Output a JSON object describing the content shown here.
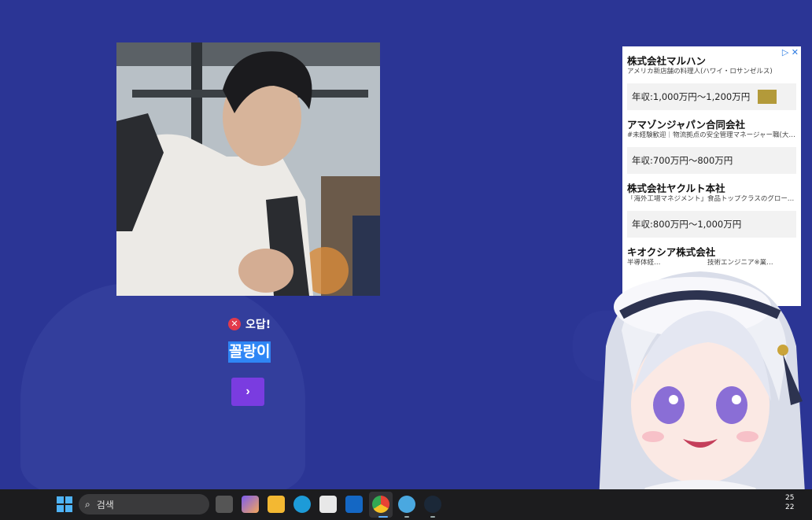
{
  "quiz": {
    "result_icon": "close-circle-icon",
    "result_text": "오답!",
    "answer": "꼴랑이",
    "next_icon": "chevron-right-icon",
    "next_glyph": "›"
  },
  "ad": {
    "top_icons": "▷ ✕",
    "items": [
      {
        "company": "株式会社マルハン",
        "subtitle": "アメリカ新店舗の料理人(ハワイ・ロサンゼルス)",
        "salary": "年収:1,000万円〜1,200万円",
        "has_swatch": true
      },
      {
        "company": "アマゾンジャパン合同会社",
        "subtitle": "#未経験歓迎｜物流拠点の安全管理マネージャー職(大阪)",
        "salary": "年収:700万円〜800万円",
        "has_swatch": false
      },
      {
        "company": "株式会社ヤクルト本社",
        "subtitle": "「海外工場マネジメント」食品トップクラスのグローバル…",
        "salary": "年収:800万円〜1,000万円",
        "has_swatch": false
      },
      {
        "company": "キオクシア株式会社",
        "subtitle": "半導体経…　　　　　　　技術エンジニア※業…",
        "salary": "",
        "has_swatch": false
      }
    ]
  },
  "taskbar": {
    "search_placeholder": "검색",
    "clock_line1": "25",
    "clock_line2": "22"
  },
  "colors": {
    "background": "#2b3595",
    "answer_highlight": "#2f86f5",
    "next_button": "#7a3ce0",
    "error": "#e23a4b"
  }
}
